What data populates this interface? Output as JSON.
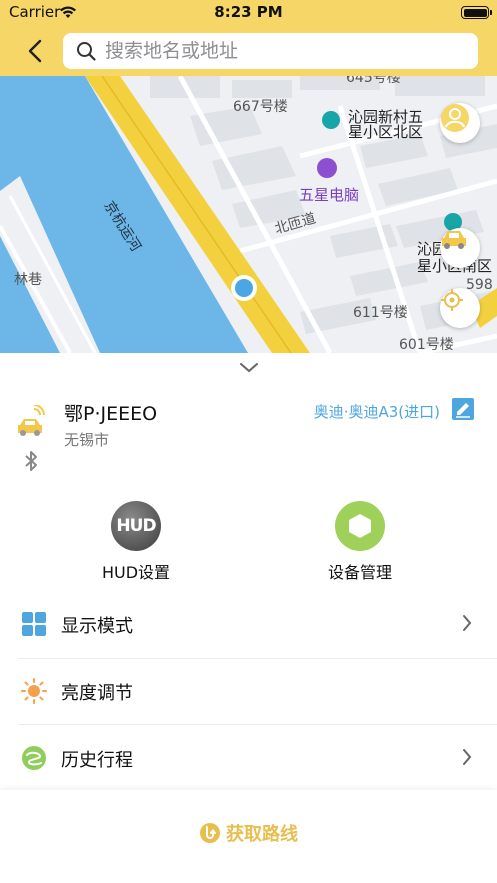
{
  "status_bar": {
    "carrier": "Carrier",
    "time": "8:23 PM"
  },
  "search": {
    "placeholder": "搜索地名或地址"
  },
  "map": {
    "labels": {
      "building_645": "645号楼",
      "building_667": "667号楼",
      "poi_qinyuan_north": "沁园新村五星小区北区",
      "poi_qinyuan_north_line1": "沁园新村五",
      "poi_qinyuan_north_line2": "星小区北区",
      "poi_computer": "五星电脑",
      "road_beihuo": "北匝道",
      "river": "京杭运河",
      "alley": "林巷",
      "poi_qinyuan_south_line1": "沁园",
      "poi_qinyuan_south_line2": "星小区南区",
      "building_598": "598",
      "building_611": "611号楼",
      "building_601": "601号楼"
    },
    "colors": {
      "water": "#6db7e8",
      "road": "#f3d13e",
      "land": "#eef0f3",
      "block": "#dfe2e7"
    }
  },
  "vehicle": {
    "plate": "鄂P·JEEEO",
    "city": "无锡市",
    "model": "奥迪·奥迪A3(进口)"
  },
  "tools": {
    "hud": {
      "icon_text": "HUD",
      "label": "HUD设置"
    },
    "device": {
      "label": "设备管理"
    }
  },
  "menu": {
    "display_mode": "显示模式",
    "brightness": "亮度调节",
    "history": "历史行程"
  },
  "bottom": {
    "get_route": "获取路线"
  },
  "colors": {
    "accent_yellow": "#f6d667",
    "link_blue": "#4da6e0",
    "route_gold": "#e8be4f",
    "device_green": "#9fd15a"
  }
}
